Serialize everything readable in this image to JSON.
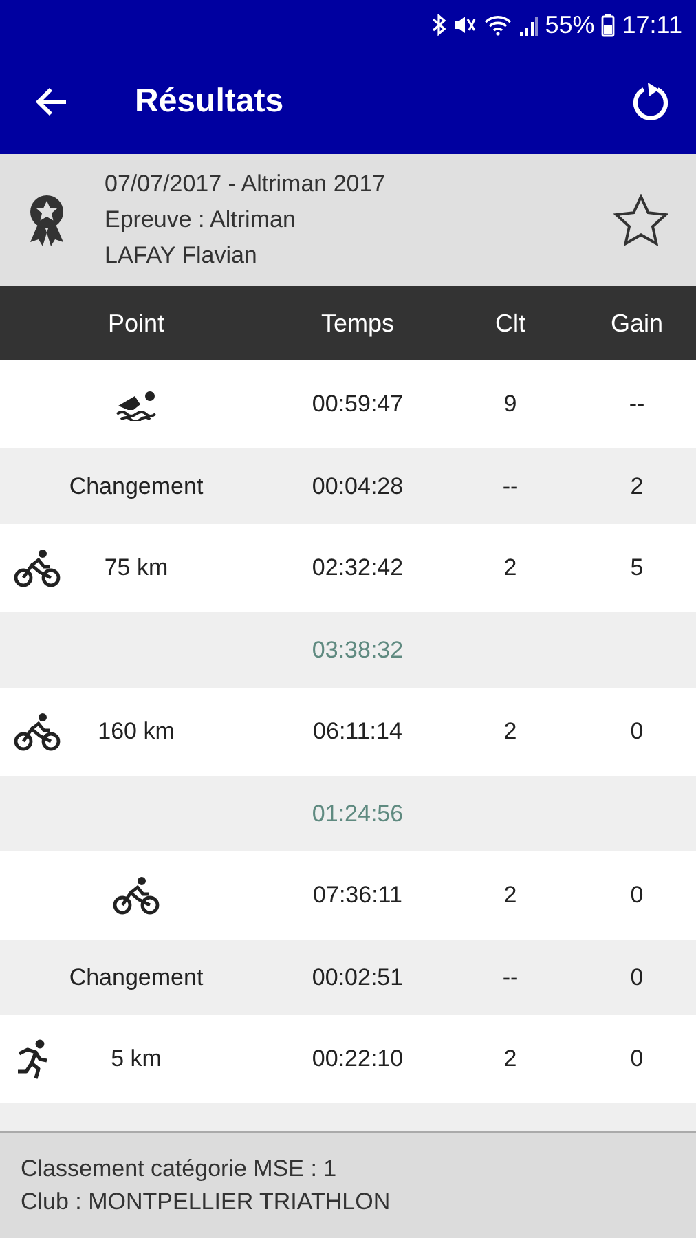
{
  "status_bar": {
    "battery": "55%",
    "time": "17:11"
  },
  "toolbar": {
    "title": "Résultats"
  },
  "race": {
    "line_1": "07/07/2017 - Altriman 2017",
    "line_2": "Epreuve : Altriman",
    "line_3": "LAFAY Flavian",
    "favorite": false
  },
  "table": {
    "columns": [
      "Point",
      "Temps",
      "Clt",
      "Gain"
    ],
    "rows": [
      {
        "kind": "swim",
        "time": "00:59:47",
        "clt": "9",
        "gain": "--"
      },
      {
        "kind": "split",
        "label": "Changement",
        "time": "00:04:28",
        "clt": "--",
        "gain": "2"
      },
      {
        "kind": "bike",
        "label": "75 km",
        "time": "02:32:42",
        "clt": "2",
        "gain": "5"
      },
      {
        "kind": "interval",
        "time": "03:38:32"
      },
      {
        "kind": "bike",
        "label": "160 km",
        "time": "06:11:14",
        "clt": "2",
        "gain": "0"
      },
      {
        "kind": "interval",
        "time": "01:24:56"
      },
      {
        "kind": "bike",
        "time": "07:36:11",
        "clt": "2",
        "gain": "0"
      },
      {
        "kind": "split",
        "label": "Changement",
        "time": "00:02:51",
        "clt": "--",
        "gain": "0"
      },
      {
        "kind": "run",
        "label": "5 km",
        "time": "00:22:10",
        "clt": "2",
        "gain": "0"
      }
    ]
  },
  "footer": {
    "line_1": "Classement catégorie MSE : 1",
    "line_2": "Club : MONTPELLIER TRIATHLON"
  }
}
